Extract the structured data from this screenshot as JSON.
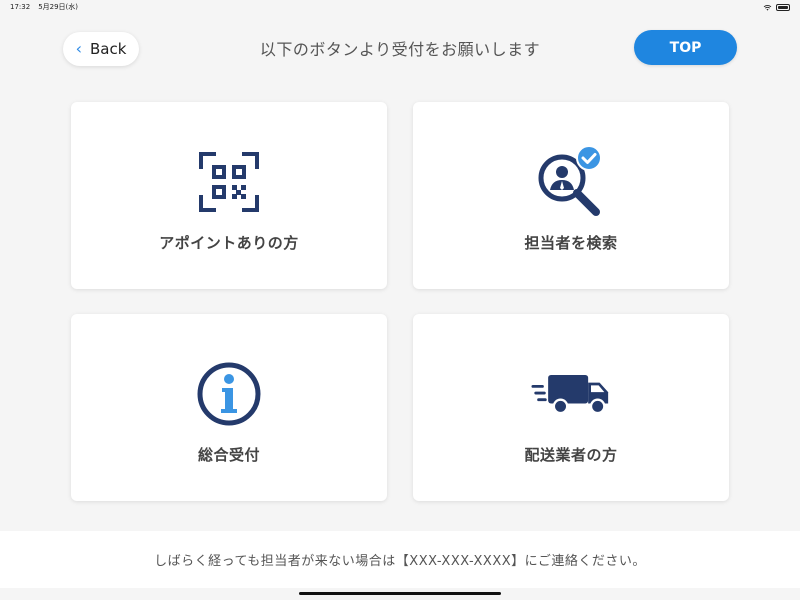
{
  "status_bar": {
    "time": "17:32",
    "date": "5月29日(水)"
  },
  "header": {
    "back_label": "Back",
    "title": "以下のボタンより受付をお願いします",
    "top_label": "TOP"
  },
  "cards": [
    {
      "label": "アポイントありの方",
      "icon": "qr-code-icon"
    },
    {
      "label": "担当者を検索",
      "icon": "search-person-icon"
    },
    {
      "label": "総合受付",
      "icon": "info-icon"
    },
    {
      "label": "配送業者の方",
      "icon": "delivery-truck-icon"
    }
  ],
  "footer": {
    "message": "しばらく経っても担当者が来ない場合は【XXX-XXX-XXXX】にご連絡ください。"
  },
  "colors": {
    "accent": "#1f86e0",
    "icon_navy": "#243a6b",
    "icon_blue": "#3b95e3"
  }
}
